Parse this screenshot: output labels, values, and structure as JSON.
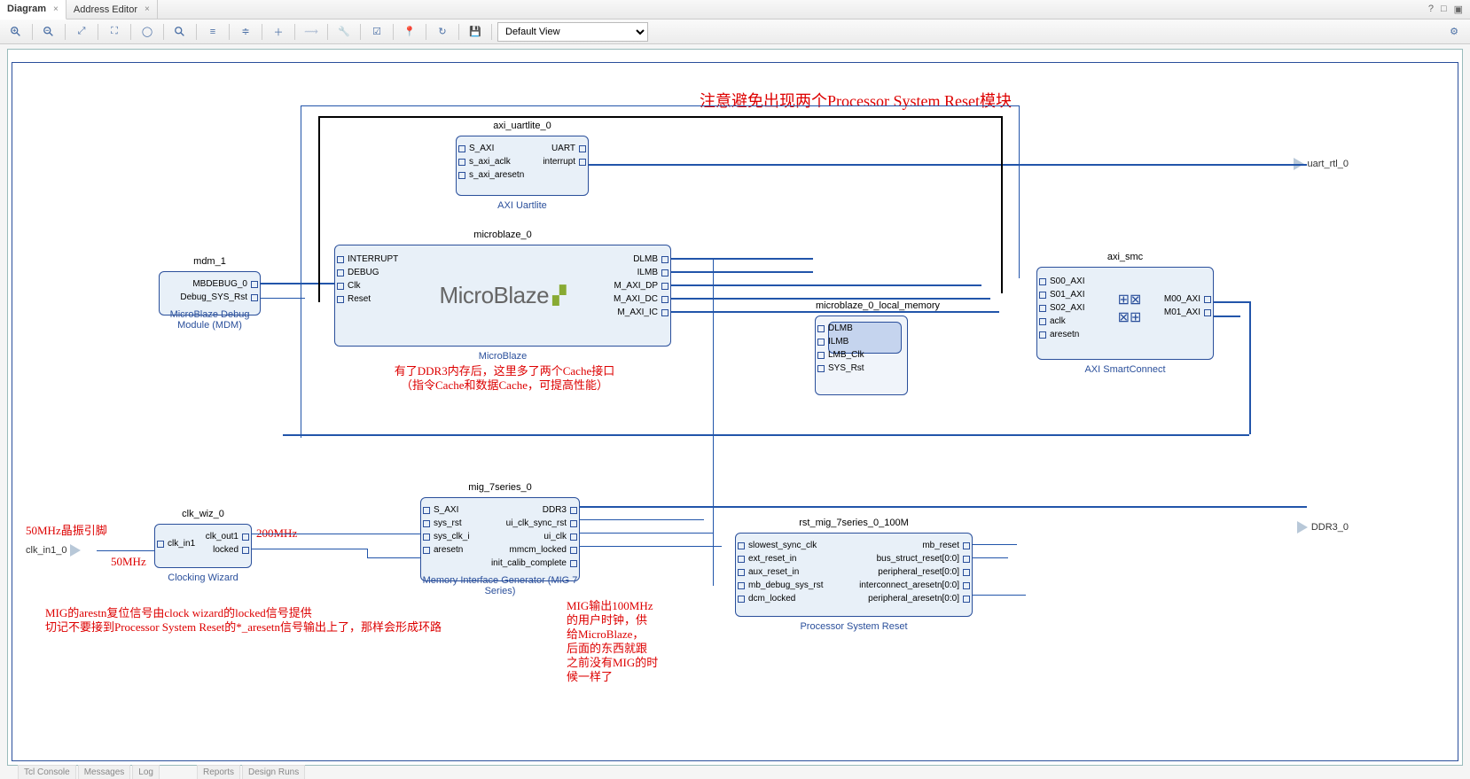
{
  "tabs": {
    "diagram": "Diagram",
    "address": "Address Editor"
  },
  "toolbar": {
    "view": "Default View"
  },
  "annotations": {
    "top": "注意避免出现两个Processor System Reset模块",
    "cache": "有了DDR3内存后，这里多了两个Cache接口\n（指令Cache和数据Cache，可提高性能）",
    "clk_pin": "50MHz晶振引脚",
    "clk_in": "50MHz",
    "clk_out": "200MHz",
    "mig_reset": "MIG的arestn复位信号由clock wizard的locked信号提供\n切记不要接到Processor System Reset的*_aresetn信号输出上了，那样会形成环路",
    "mig_clk": "MIG输出100MHz\n的用户时钟，供\n给MicroBlaze，\n后面的东西就跟\n之前没有MIG的时\n候一样了"
  },
  "ext_ports": {
    "clk_in": "clk_in1_0",
    "uart": "uart_rtl_0",
    "ddr": "DDR3_0"
  },
  "blocks": {
    "mdm": {
      "inst": "mdm_1",
      "caption": "MicroBlaze Debug Module (MDM)",
      "ports_r": [
        "MBDEBUG_0",
        "Debug_SYS_Rst"
      ]
    },
    "uartlite": {
      "inst": "axi_uartlite_0",
      "caption": "AXI Uartlite",
      "ports_l": [
        "S_AXI",
        "s_axi_aclk",
        "s_axi_aresetn"
      ],
      "ports_r": [
        "UART",
        "interrupt"
      ]
    },
    "microblaze": {
      "inst": "microblaze_0",
      "caption": "MicroBlaze",
      "logo": "MicroBlaze",
      "ports_l": [
        "INTERRUPT",
        "DEBUG",
        "Clk",
        "Reset"
      ],
      "ports_r": [
        "DLMB",
        "ILMB",
        "M_AXI_DP",
        "M_AXI_DC",
        "M_AXI_IC"
      ]
    },
    "localmem": {
      "inst": "microblaze_0_local_memory",
      "ports_l": [
        "DLMB",
        "ILMB",
        "LMB_Clk",
        "SYS_Rst"
      ]
    },
    "smc": {
      "inst": "axi_smc",
      "caption": "AXI SmartConnect",
      "ports_l": [
        "S00_AXI",
        "S01_AXI",
        "S02_AXI",
        "aclk",
        "aresetn"
      ],
      "ports_r": [
        "M00_AXI",
        "M01_AXI"
      ]
    },
    "clkwiz": {
      "inst": "clk_wiz_0",
      "caption": "Clocking Wizard",
      "ports_l": [
        "clk_in1"
      ],
      "ports_r": [
        "clk_out1",
        "locked"
      ]
    },
    "mig": {
      "inst": "mig_7series_0",
      "caption": "Memory Interface Generator (MIG 7 Series)",
      "ports_l": [
        "S_AXI",
        "sys_rst",
        "sys_clk_i",
        "aresetn"
      ],
      "ports_r": [
        "DDR3",
        "ui_clk_sync_rst",
        "ui_clk",
        "mmcm_locked",
        "init_calib_complete"
      ]
    },
    "rst": {
      "inst": "rst_mig_7series_0_100M",
      "caption": "Processor System Reset",
      "ports_l": [
        "slowest_sync_clk",
        "ext_reset_in",
        "aux_reset_in",
        "mb_debug_sys_rst",
        "dcm_locked"
      ],
      "ports_r": [
        "mb_reset",
        "bus_struct_reset[0:0]",
        "peripheral_reset[0:0]",
        "interconnect_aresetn[0:0]",
        "peripheral_aresetn[0:0]"
      ]
    }
  },
  "bottom_tabs": [
    "Tcl Console",
    "Messages",
    "Log",
    "Reports",
    "Design Runs"
  ]
}
